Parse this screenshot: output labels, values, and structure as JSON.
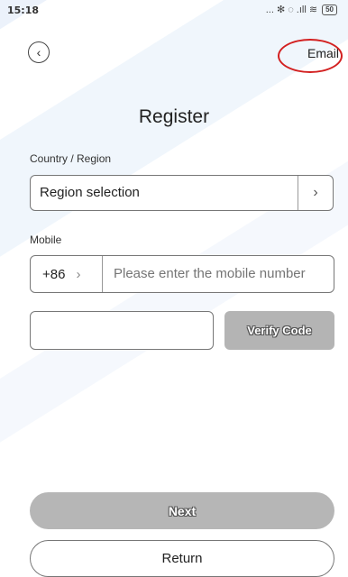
{
  "status_bar": {
    "time": "15:18",
    "icons_text": "... ✻ ◌ .ıll ≋",
    "battery": "50"
  },
  "header": {
    "back_icon": "chevron-left-icon",
    "email_link": "Email"
  },
  "title": "Register",
  "country_region": {
    "label": "Country / Region",
    "value": "Region selection",
    "chevron": "›"
  },
  "mobile": {
    "label": "Mobile",
    "country_code": "+86",
    "chevron": "›",
    "placeholder": "Please enter the mobile number"
  },
  "verify": {
    "code_value": "",
    "button_label": "Verify Code"
  },
  "actions": {
    "next_label": "Next",
    "return_label": "Return"
  },
  "colors": {
    "disabled_button": "#b6b6b6",
    "annotation_circle": "#d32020"
  }
}
